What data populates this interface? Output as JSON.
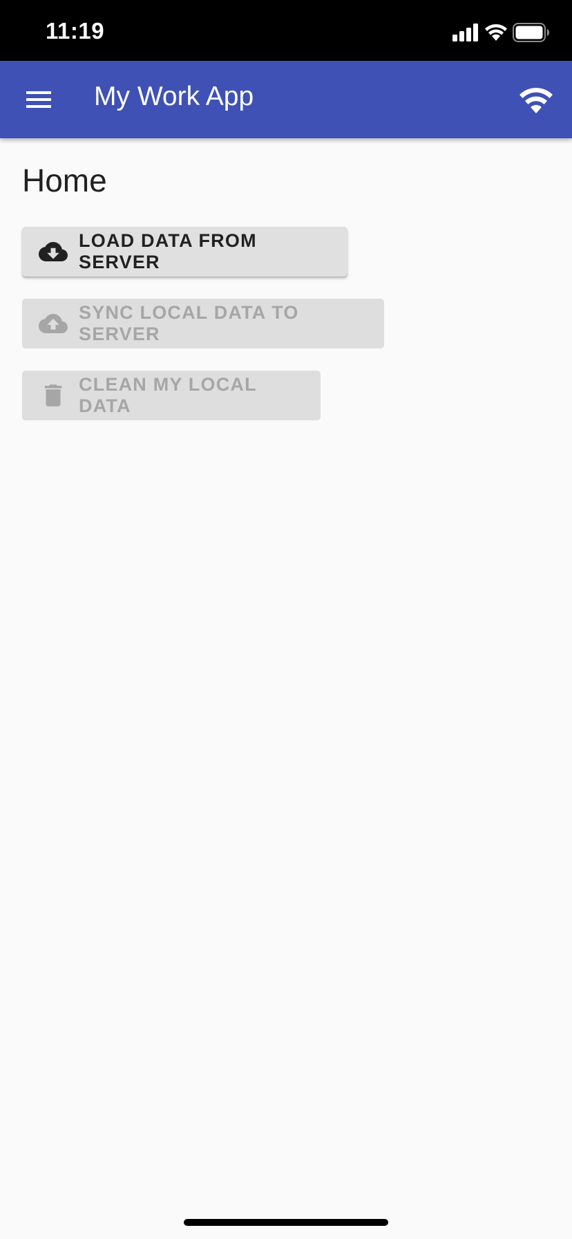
{
  "status_bar": {
    "time": "11:19",
    "icons": [
      "cellular-signal-icon",
      "wifi-icon",
      "battery-icon"
    ]
  },
  "app_bar": {
    "title": "My Work App",
    "menu_icon": "hamburger-menu-icon",
    "action_icon": "wifi-icon",
    "color": "#3f51b5"
  },
  "page": {
    "title": "Home"
  },
  "buttons": [
    {
      "label": "LOAD DATA FROM SERVER",
      "icon": "cloud-download-icon",
      "enabled": true
    },
    {
      "label": "SYNC LOCAL DATA TO SERVER",
      "icon": "cloud-upload-icon",
      "enabled": false
    },
    {
      "label": "CLEAN MY LOCAL DATA",
      "icon": "trash-icon",
      "enabled": false
    }
  ]
}
